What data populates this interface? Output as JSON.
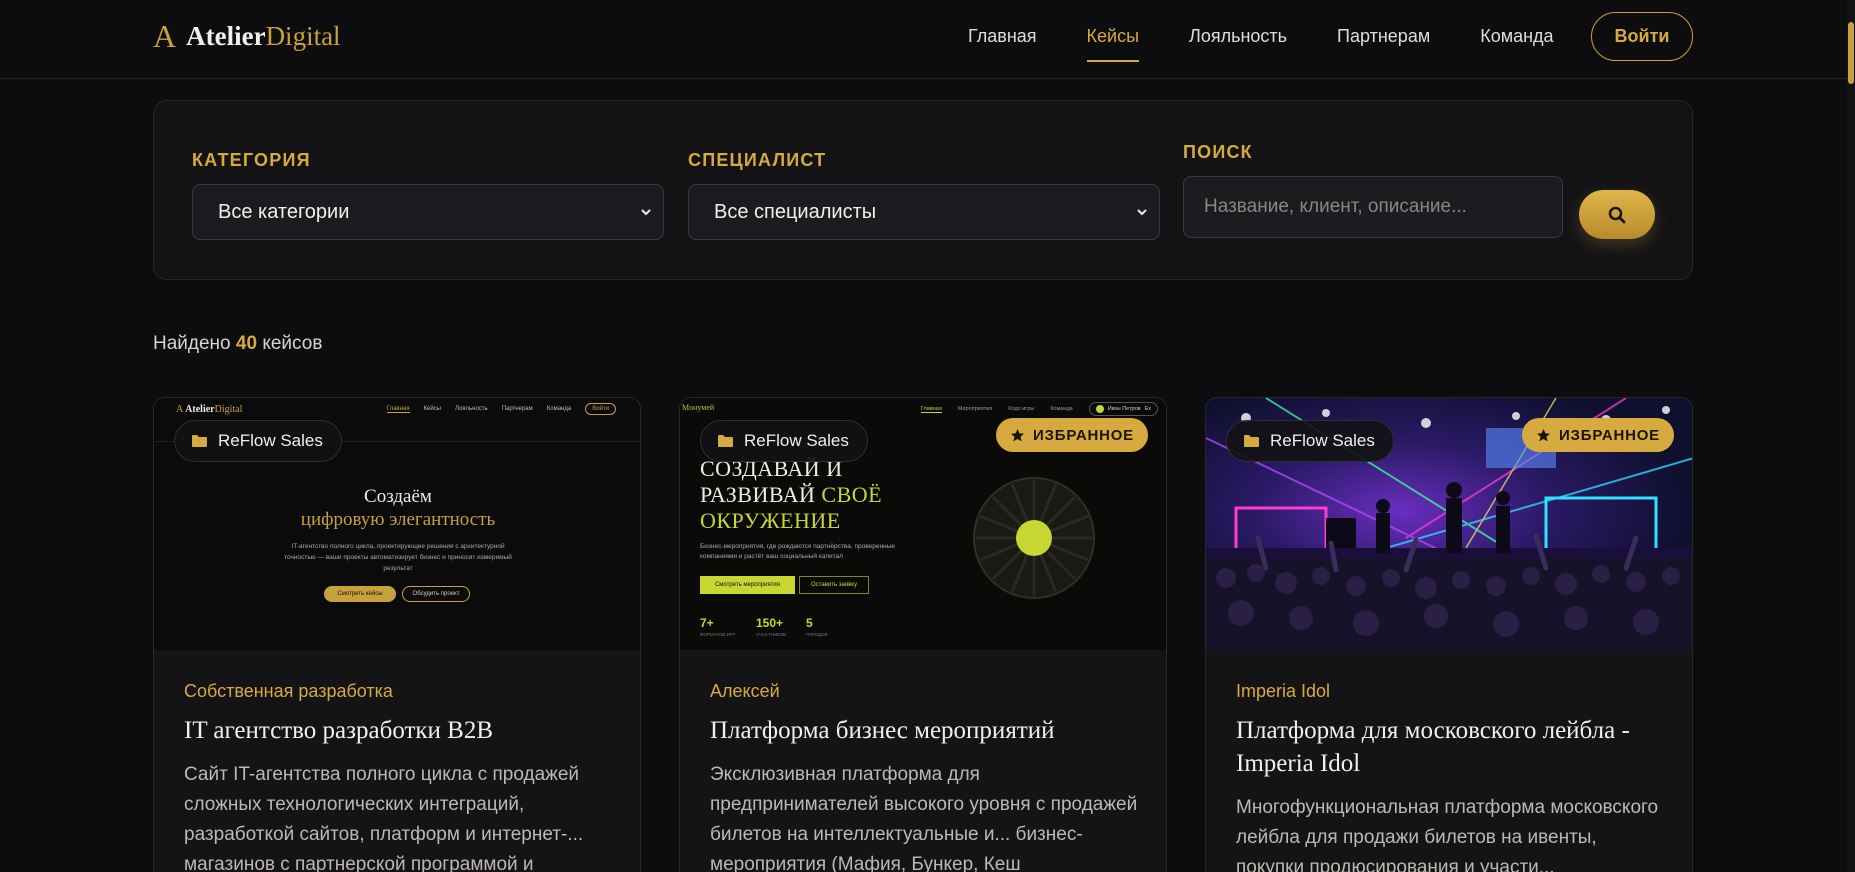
{
  "header": {
    "logo_mark": "A",
    "logo_part1": "Atelier",
    "logo_part2": "Digital",
    "nav": [
      "Главная",
      "Кейсы",
      "Лояльность",
      "Партнерам",
      "Команда"
    ],
    "active_nav": "Кейсы",
    "login_label": "Войти"
  },
  "filters": {
    "category_label": "КАТЕГОРИЯ",
    "category_value": "Все категории",
    "specialist_label": "СПЕЦИАЛИСТ",
    "specialist_value": "Все специалисты",
    "search_label": "ПОИСК",
    "search_placeholder": "Название, клиент, описание..."
  },
  "results": {
    "prefix": "Найдено",
    "count": "40",
    "suffix": "кейсов"
  },
  "cards": [
    {
      "chip": "ReFlow Sales",
      "author": "Собственная разработка",
      "title": "IT агентство разработки B2B",
      "desc": "Сайт IT-агентства полного цикла с продажей сложных технологических интеграций, разработкой сайтов, платформ и интернет-... магазинов с партнерской программой и",
      "thumb": {
        "logo_a": "Atelier",
        "logo_b": "Digital",
        "links": [
          "Главная",
          "Кейсы",
          "Лояльность",
          "Партнерам",
          "Команда",
          "Войти"
        ],
        "h1": "Создаём",
        "h2": "цифровую элегантность",
        "p": "IT-агентство полного цикла, проектирующее решения с архитектурной точностью — ваши проекты автоматизирует бизнес и приносят измеримый результат",
        "b1": "Смотреть кейсы",
        "b2": "Обсудить проект"
      }
    },
    {
      "chip": "ReFlow Sales",
      "fav": "ИЗБРАННОЕ",
      "author": "Алексей",
      "title": "Платформа бизнес мероприятий",
      "desc": "Эксклюзивная платформа для предпринимателей высокого уровня с продажей билетов на интеллектуальные и... бизнес-мероприятия (Мафия, Бункер, Кеш",
      "thumb": {
        "logo": "Mонумей",
        "links": [
          "Главная",
          "Мероприятия",
          "Кодо игры",
          "Команда"
        ],
        "user": "Иван Петров",
        "user_badge": "Ех",
        "h_line1": "СОЗДАВАЙ И",
        "h_line2a": "РАЗВИВАЙ ",
        "h_line2b": "СВОЁ",
        "h_line3": "ОКРУЖЕНИЕ",
        "p": "Бизнес-мероприятия, где рождаются партнёрства, проверенные компаниями и растёт ваш социальный капитал",
        "b1": "Смотреть мероприятия",
        "b2": "Оставить заявку",
        "stats": [
          {
            "value": "7+",
            "label": "ФОРМАТОВ ИГР"
          },
          {
            "value": "150+",
            "label": "УЧАСТНИКОВ"
          },
          {
            "value": "5",
            "label": "ГОРОДОВ"
          }
        ]
      }
    },
    {
      "chip": "ReFlow Sales",
      "fav": "ИЗБРАННОЕ",
      "author": "Imperia Idol",
      "title": "Платформа для московского лейбла - Imperia Idol",
      "desc": "Многофункциональная платформа московского лейбла для продажи билетов на ивенты, покупки продюсирования и участи..."
    }
  ],
  "colors": {
    "background": "#0d0d0f",
    "gold": "#d6aa3f",
    "lime": "#c8d631"
  }
}
